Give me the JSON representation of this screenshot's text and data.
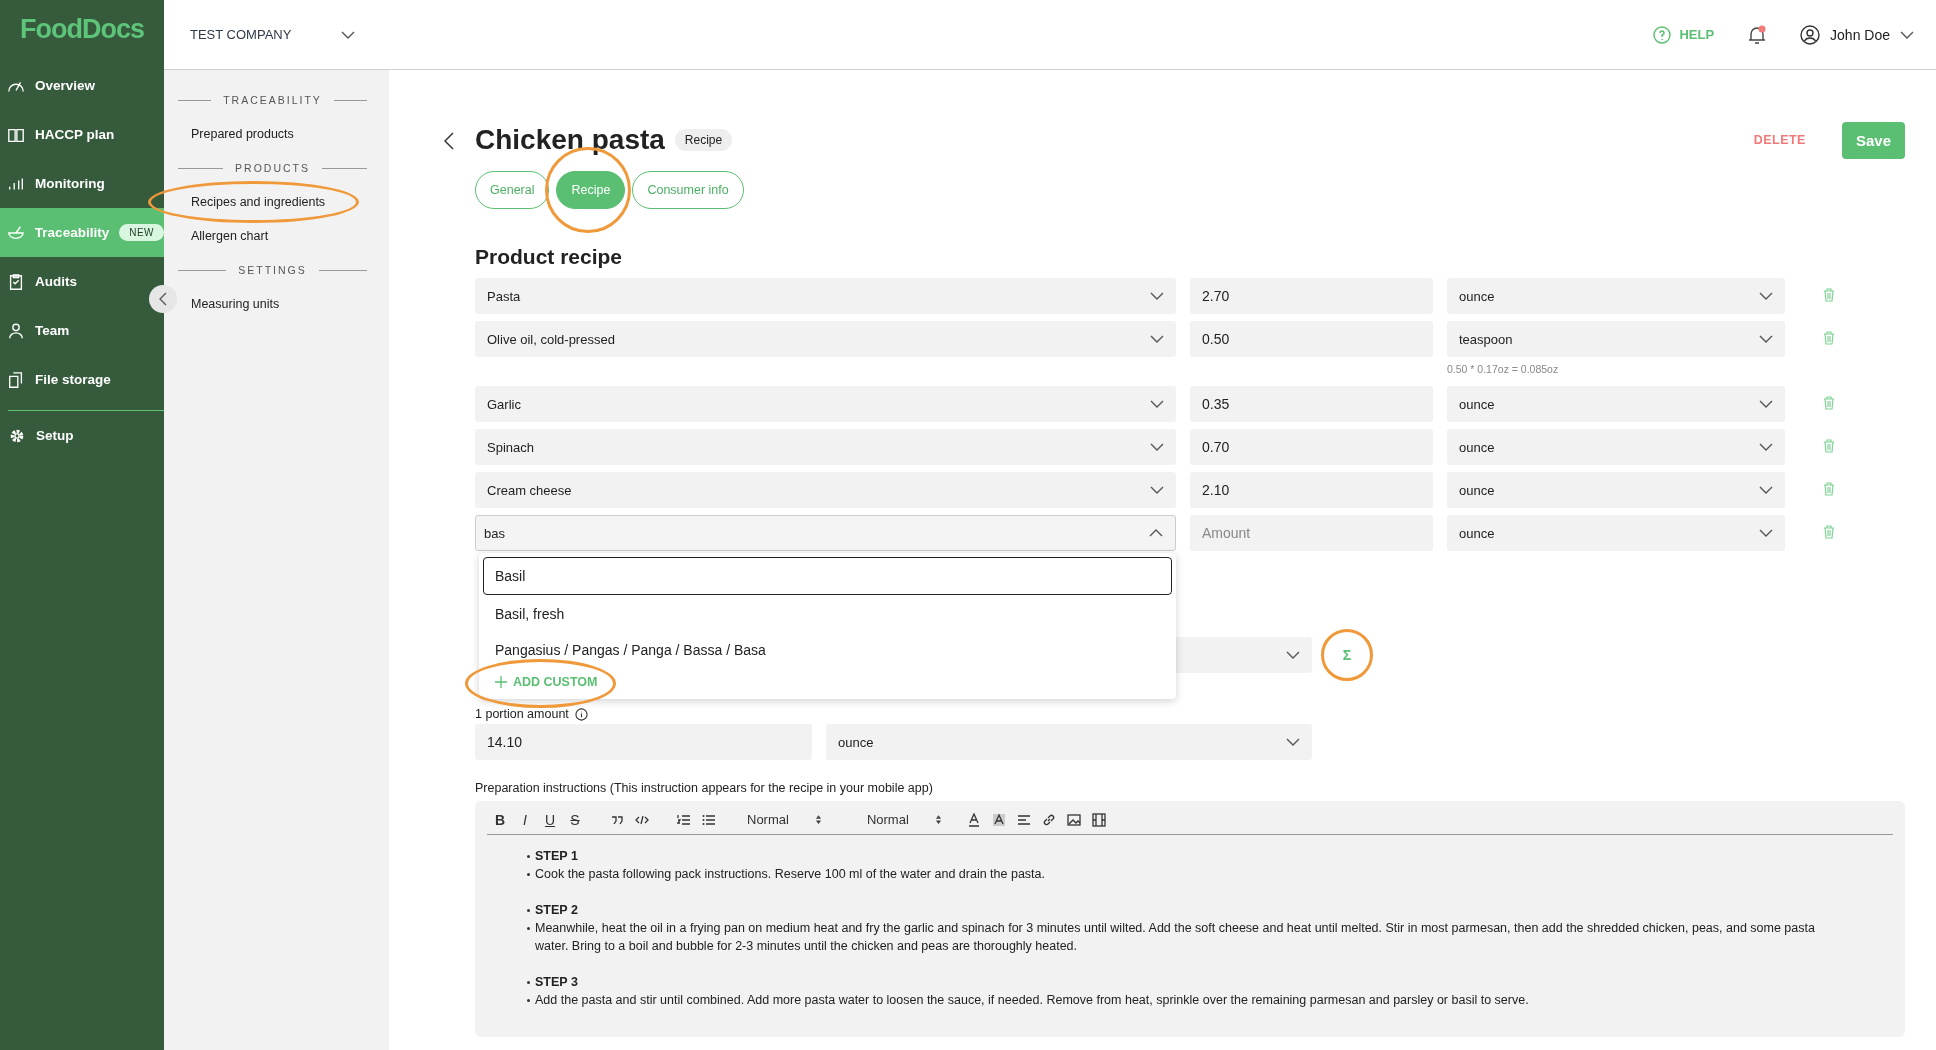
{
  "sidebar": {
    "logo": "FoodDocs",
    "items": [
      {
        "label": "Overview",
        "kind": "gauge",
        "selected": false
      },
      {
        "label": "HACCP plan",
        "kind": "book",
        "selected": false
      },
      {
        "label": "Monitoring",
        "kind": "bars",
        "selected": false
      },
      {
        "label": "Traceability",
        "kind": "bowl",
        "selected": true,
        "badge": "NEW"
      },
      {
        "label": "Audits",
        "kind": "clipboard",
        "selected": false
      },
      {
        "label": "Team",
        "kind": "person",
        "selected": false
      },
      {
        "label": "File storage",
        "kind": "files",
        "selected": false
      },
      {
        "label": "Setup",
        "kind": "gear",
        "selected": false
      }
    ]
  },
  "header": {
    "company": "TEST COMPANY",
    "help": "HELP",
    "user": "John Doe"
  },
  "submenu": [
    {
      "heading": "TRACEABILITY",
      "items": [
        {
          "label": "Prepared products",
          "circled": false
        }
      ]
    },
    {
      "heading": "PRODUCTS",
      "items": [
        {
          "label": "Recipes and ingredients",
          "circled": true
        },
        {
          "label": "Allergen chart",
          "circled": false
        }
      ]
    },
    {
      "heading": "SETTINGS",
      "items": [
        {
          "label": "Measuring units",
          "circled": false
        }
      ]
    }
  ],
  "page": {
    "title": "Chicken pasta",
    "badge": "Recipe",
    "delete": "DELETE",
    "save": "Save",
    "tabs": [
      {
        "label": "General",
        "selected": false,
        "circled": false
      },
      {
        "label": "Recipe",
        "selected": true,
        "circled": true
      },
      {
        "label": "Consumer info",
        "selected": false,
        "circled": false
      }
    ],
    "section": "Product recipe",
    "ingredients": [
      {
        "name": "Pasta",
        "amount": "2.70",
        "unit": "ounce",
        "expanded": false
      },
      {
        "name": "Olive oil, cold-pressed",
        "amount": "0.50",
        "unit": "teaspoon",
        "note": "0.50 * 0.17oz = 0.085oz",
        "expanded": false
      },
      {
        "name": "Garlic",
        "amount": "0.35",
        "unit": "ounce",
        "expanded": false
      },
      {
        "name": "Spinach",
        "amount": "0.70",
        "unit": "ounce",
        "expanded": false
      },
      {
        "name": "Cream cheese",
        "amount": "2.10",
        "unit": "ounce",
        "expanded": false
      },
      {
        "name": "bas",
        "placeholder": "Amount",
        "unit": "ounce",
        "expanded": true
      }
    ],
    "options": [
      {
        "label": "Basil",
        "selected": true
      },
      {
        "label": "Basil, fresh",
        "selected": false
      },
      {
        "label": "Pangasius / Pangas / Panga / Bassa / Basa",
        "selected": false
      }
    ],
    "add_custom": {
      "label": "ADD CUSTOM",
      "circled": true
    },
    "sum": {
      "label": "Σ",
      "circled": true
    },
    "portion": {
      "label": "1 portion amount",
      "value": "14.10",
      "unit": "ounce"
    },
    "instructions": {
      "label": "Preparation instructions (This instruction appears for the recipe in your mobile app)",
      "toolbar": [
        {
          "kind": "bold",
          "label": "B"
        },
        {
          "kind": "italic",
          "label": "I"
        },
        {
          "kind": "underline",
          "label": "U"
        },
        {
          "kind": "strike",
          "label": "S"
        },
        {
          "kind": "sep"
        },
        {
          "kind": "quote"
        },
        {
          "kind": "code"
        },
        {
          "kind": "sep"
        },
        {
          "kind": "ol"
        },
        {
          "kind": "ul"
        },
        {
          "kind": "select",
          "label": "Normal"
        },
        {
          "kind": "select",
          "label": "Normal"
        },
        {
          "kind": "color"
        },
        {
          "kind": "background"
        },
        {
          "kind": "align"
        },
        {
          "kind": "link"
        },
        {
          "kind": "image"
        },
        {
          "kind": "video"
        }
      ],
      "steps": [
        {
          "heading": "STEP 1",
          "text": "Cook the pasta following pack instructions. Reserve 100 ml of the water and drain the pasta."
        },
        {
          "heading": "STEP 2",
          "text": "Meanwhile, heat the oil in a frying pan on medium heat and fry the garlic and spinach for 3 minutes until wilted. Add the soft cheese and heat until melted. Stir in most parmesan, then add the shredded chicken, peas, and some pasta water. Bring to a boil and bubble for 2-3 minutes until the chicken and peas are thoroughly heated."
        },
        {
          "heading": "STEP 3",
          "text": "Add the pasta and stir until combined. Add more pasta water to loosen the sauce, if needed. Remove from heat, sprinkle over the remaining parmesan and parsley or basil to serve."
        }
      ]
    }
  }
}
